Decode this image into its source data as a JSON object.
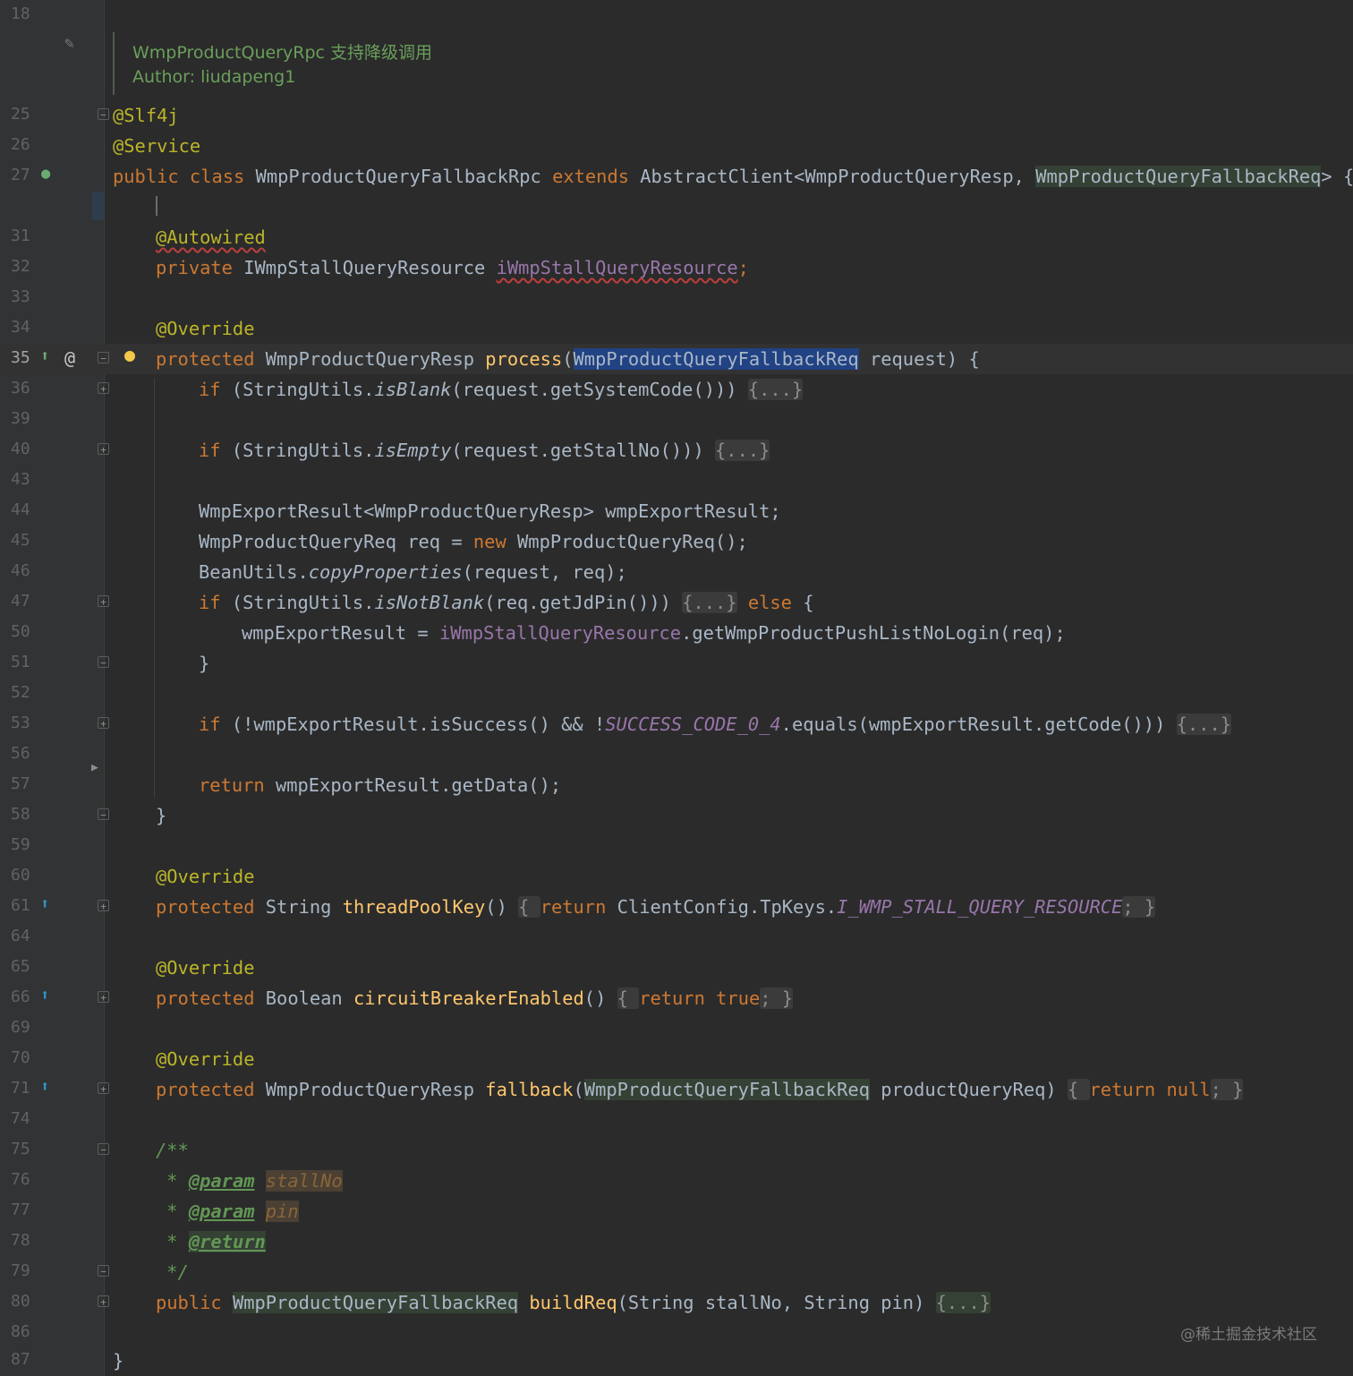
{
  "editor": {
    "doc_comment": {
      "line_number": "18",
      "text1": "WmpProductQueryRpc 支持降级调用",
      "text2": "Author: liudapeng1"
    },
    "lines": [
      {
        "n": "25"
      },
      {
        "n": "26"
      },
      {
        "n": "27"
      },
      {
        "n": "31"
      },
      {
        "n": "32"
      },
      {
        "n": "33"
      },
      {
        "n": "34"
      },
      {
        "n": "35"
      },
      {
        "n": "36"
      },
      {
        "n": "39"
      },
      {
        "n": "40"
      },
      {
        "n": "43"
      },
      {
        "n": "44"
      },
      {
        "n": "45"
      },
      {
        "n": "46"
      },
      {
        "n": "47"
      },
      {
        "n": "50"
      },
      {
        "n": "51"
      },
      {
        "n": "52"
      },
      {
        "n": "53"
      },
      {
        "n": "56"
      },
      {
        "n": "57"
      },
      {
        "n": "58"
      },
      {
        "n": "59"
      },
      {
        "n": "60"
      },
      {
        "n": "61"
      },
      {
        "n": "64"
      },
      {
        "n": "65"
      },
      {
        "n": "66"
      },
      {
        "n": "69"
      },
      {
        "n": "70"
      },
      {
        "n": "71"
      },
      {
        "n": "74"
      },
      {
        "n": "75"
      },
      {
        "n": "76"
      },
      {
        "n": "77"
      },
      {
        "n": "78"
      },
      {
        "n": "79"
      },
      {
        "n": "80"
      },
      {
        "n": "86"
      },
      {
        "n": "87"
      }
    ],
    "code": {
      "l25": "@Slf4j",
      "l26": "@Service",
      "l27": [
        "public class ",
        "WmpProductQueryFallbackRpc ",
        "extends ",
        "AbstractClient<WmpProductQueryResp, ",
        "WmpProductQueryFallbackReq",
        "> {"
      ],
      "l31": "@Autowired",
      "l32": [
        "private ",
        "IWmpStallQueryResource ",
        "iWmpStallQueryResource",
        ";"
      ],
      "l34": "@Override",
      "l35": [
        "protected ",
        "WmpProductQueryResp ",
        "process",
        "(",
        "WmpProductQueryFallbackReq",
        " request) {"
      ],
      "l36": [
        "if ",
        "(StringUtils.",
        "isBlank",
        "(request.getSystemCode())) ",
        "{...}"
      ],
      "l40": [
        "if ",
        "(StringUtils.",
        "isEmpty",
        "(request.getStallNo())) ",
        "{...}"
      ],
      "l44": "WmpExportResult<WmpProductQueryResp> wmpExportResult;",
      "l45": [
        "WmpProductQueryReq req = ",
        "new ",
        "WmpProductQueryReq();"
      ],
      "l46": [
        "BeanUtils.",
        "copyProperties",
        "(request, req);"
      ],
      "l47": [
        "if ",
        "(StringUtils.",
        "isNotBlank",
        "(req.getJdPin())) ",
        "{...}",
        " else ",
        "{"
      ],
      "l50": [
        "wmpExportResult = ",
        "iWmpStallQueryResource",
        ".getWmpProductPushListNoLogin(req);"
      ],
      "l51": "}",
      "l53": [
        "if ",
        "(!wmpExportResult.isSuccess() && !",
        "SUCCESS_CODE_0_4",
        ".equals(wmpExportResult.getCode())) ",
        "{...}"
      ],
      "l57": [
        "return ",
        "wmpExportResult.getData();"
      ],
      "l58": "}",
      "l60": "@Override",
      "l61": [
        "protected ",
        "String ",
        "threadPoolKey",
        "() ",
        "{ ",
        "return ",
        "ClientConfig.TpKeys.",
        "I_WMP_STALL_QUERY_RESOURCE",
        "; }"
      ],
      "l65": "@Override",
      "l66": [
        "protected ",
        "Boolean ",
        "circuitBreakerEnabled",
        "() ",
        "{ ",
        "return ",
        "true",
        "; }"
      ],
      "l70": "@Override",
      "l71": [
        "protected ",
        "WmpProductQueryResp ",
        "fallback",
        "(",
        "WmpProductQueryFallbackReq",
        " productQueryReq) ",
        "{ ",
        "return ",
        "null",
        "; }"
      ],
      "l75": "/**",
      "l76": [
        " * ",
        "@param",
        " ",
        "stallNo"
      ],
      "l77": [
        " * ",
        "@param",
        " ",
        "pin"
      ],
      "l78": [
        " * ",
        "@return"
      ],
      "l79": " */",
      "l80": [
        "public ",
        "WmpProductQueryFallbackReq",
        " ",
        "buildReq",
        "(String stallNo, String pin) ",
        "{...}"
      ],
      "l87": "}"
    },
    "gutter_icons": {
      "edit": "pencil-icon",
      "bean": "spring-bean-icon",
      "override_up": "override-up-icon",
      "at": "@",
      "bulb": "lightbulb-icon",
      "run": "run-arrow-icon"
    }
  },
  "watermark": "@稀土掘金技术社区"
}
